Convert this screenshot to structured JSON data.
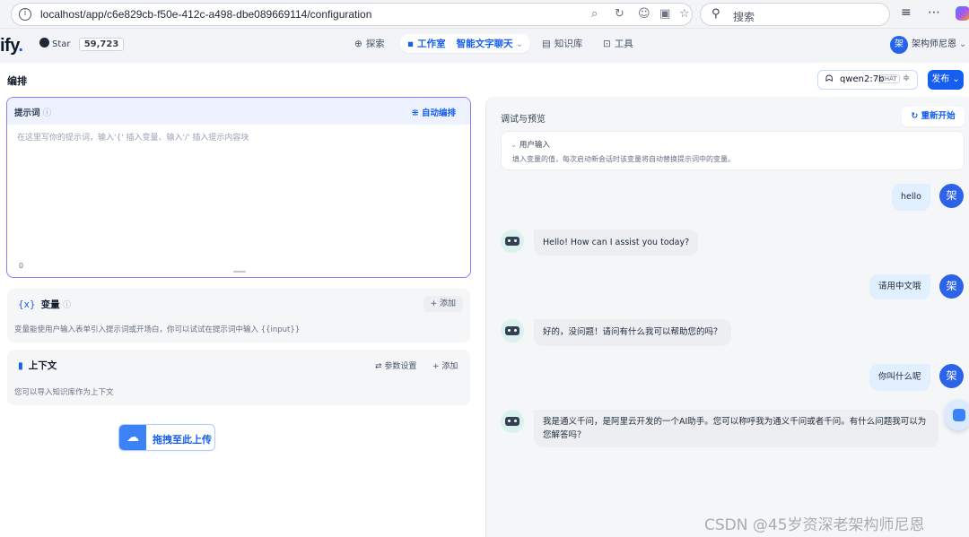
{
  "browser": {
    "url": "localhost/app/c6e829cb-f50e-412c-a498-dbe089669114/configuration",
    "search_placeholder": "搜索"
  },
  "header": {
    "logo_text": "ify",
    "logo_dot": ".",
    "github_label": "Star",
    "github_count": "59,723",
    "nav": {
      "explore": "探索",
      "studio": "工作室",
      "app_name": "智能文字聊天",
      "knowledge": "知识库",
      "tools": "工具"
    },
    "user_initial": "架",
    "user_name": "架构师尼恩"
  },
  "left": {
    "title": "编排",
    "prompt": {
      "label": "提示词",
      "auto_label": "自动编排",
      "placeholder": "在这里写你的提示词，输入'{' 插入变量、输入'/' 插入提示内容块",
      "count": "0"
    },
    "variables": {
      "title": "变量",
      "add_label": "添加",
      "desc": "变量能使用户输入表单引入提示词或开场白，你可以试试在提示词中输入 {{input}}"
    },
    "context": {
      "title": "上下文",
      "params_label": "参数设置",
      "add_label": "添加",
      "desc": "您可以导入知识库作为上下文"
    },
    "upload_label": "拖拽至此上传"
  },
  "toolbar": {
    "model_name": "qwen2:7b",
    "model_tag": "CHAT",
    "publish_label": "发布"
  },
  "right": {
    "title": "调试与预览",
    "restart_label": "重新开始",
    "user_input_title": "用户输入",
    "user_input_desc": "填入变量的值，每次启动新会话时该变量将自动替换提示词中的变量。",
    "messages": [
      {
        "role": "user",
        "text": "hello"
      },
      {
        "role": "bot",
        "text": "Hello! How can I assist you today?"
      },
      {
        "role": "user",
        "text": "请用中文哦"
      },
      {
        "role": "bot",
        "text": "好的，没问题！请问有什么我可以帮助您的吗？"
      },
      {
        "role": "user",
        "text": "你叫什么呢"
      },
      {
        "role": "bot",
        "text": "我是通义千问，是阿里云开发的一个AI助手。您可以称呼我为通义千问或者千问。有什么问题我可以为您解答吗？"
      }
    ],
    "user_avatar": "架"
  },
  "watermark": "CSDN @45岁资深老架构师尼恩"
}
